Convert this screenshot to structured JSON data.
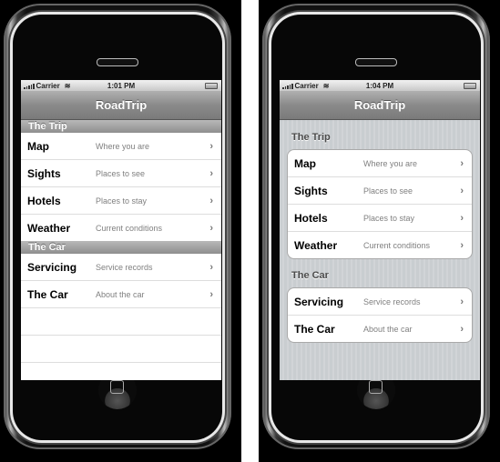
{
  "screens": [
    {
      "style": "plain",
      "status": {
        "carrier": "Carrier",
        "time": "1:01 PM"
      },
      "nav_title": "RoadTrip",
      "sections": [
        {
          "header": "The Trip",
          "rows": [
            {
              "title": "Map",
              "subtitle": "Where you are"
            },
            {
              "title": "Sights",
              "subtitle": "Places to see"
            },
            {
              "title": "Hotels",
              "subtitle": "Places to stay"
            },
            {
              "title": "Weather",
              "subtitle": "Current conditions"
            }
          ]
        },
        {
          "header": "The Car",
          "rows": [
            {
              "title": "Servicing",
              "subtitle": "Service records"
            },
            {
              "title": "The Car",
              "subtitle": "About the car"
            }
          ]
        }
      ]
    },
    {
      "style": "grouped",
      "status": {
        "carrier": "Carrier",
        "time": "1:04 PM"
      },
      "nav_title": "RoadTrip",
      "sections": [
        {
          "header": "The Trip",
          "rows": [
            {
              "title": "Map",
              "subtitle": "Where you are"
            },
            {
              "title": "Sights",
              "subtitle": "Places to see"
            },
            {
              "title": "Hotels",
              "subtitle": "Places to stay"
            },
            {
              "title": "Weather",
              "subtitle": "Current conditions"
            }
          ]
        },
        {
          "header": "The Car",
          "rows": [
            {
              "title": "Servicing",
              "subtitle": "Service records"
            },
            {
              "title": "The Car",
              "subtitle": "About the car"
            }
          ]
        }
      ]
    }
  ],
  "icons": {
    "chevron": "›",
    "wifi": "≋"
  }
}
